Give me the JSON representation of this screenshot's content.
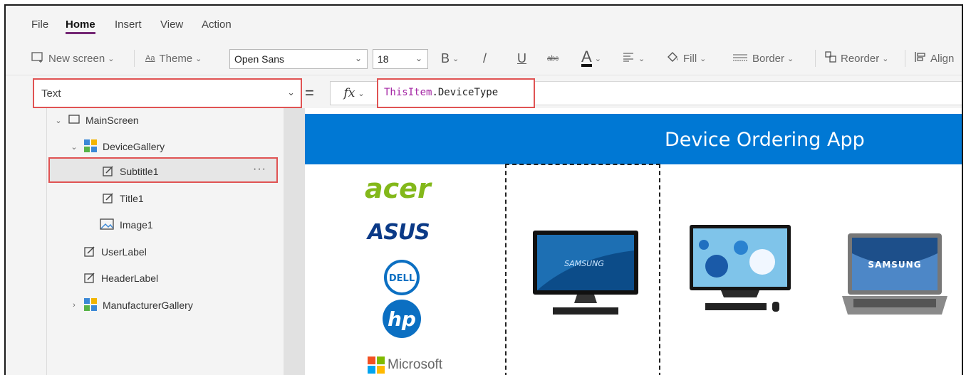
{
  "menu": {
    "items": [
      "File",
      "Home",
      "Insert",
      "View",
      "Action"
    ],
    "active": "Home"
  },
  "toolbar": {
    "new_screen": "New screen",
    "theme": "Theme",
    "font": "Open Sans",
    "font_size": "18",
    "bold": "B",
    "italic": "/",
    "underline": "U",
    "strike": "abc",
    "font_color": "A",
    "fill": "Fill",
    "border": "Border",
    "reorder": "Reorder",
    "align": "Align"
  },
  "formula_bar": {
    "property": "Text",
    "equals": "=",
    "fx": "fx",
    "formula_keyword": "ThisItem",
    "formula_rest": ".DeviceType"
  },
  "tree": {
    "items": [
      {
        "label": "MainScreen",
        "icon": "screen-icon"
      },
      {
        "label": "DeviceGallery",
        "icon": "gallery-icon"
      },
      {
        "label": "Subtitle1",
        "icon": "label-icon"
      },
      {
        "label": "Title1",
        "icon": "label-icon"
      },
      {
        "label": "Image1",
        "icon": "image-icon"
      },
      {
        "label": "UserLabel",
        "icon": "label-icon"
      },
      {
        "label": "HeaderLabel",
        "icon": "label-icon"
      },
      {
        "label": "ManufacturerGallery",
        "icon": "gallery-icon"
      }
    ],
    "more": "···"
  },
  "canvas": {
    "app_title": "Device Ordering App",
    "brands": [
      "acer",
      "ASUS",
      "DELL",
      "hp",
      "Microsoft"
    ],
    "device_logos": [
      "SAMSUNG",
      "SAMSUNG"
    ]
  },
  "colors": {
    "accent": "#742774",
    "highlight": "#e05353",
    "header_blue": "#0078d4",
    "formula_keyword": "#a323a3"
  }
}
